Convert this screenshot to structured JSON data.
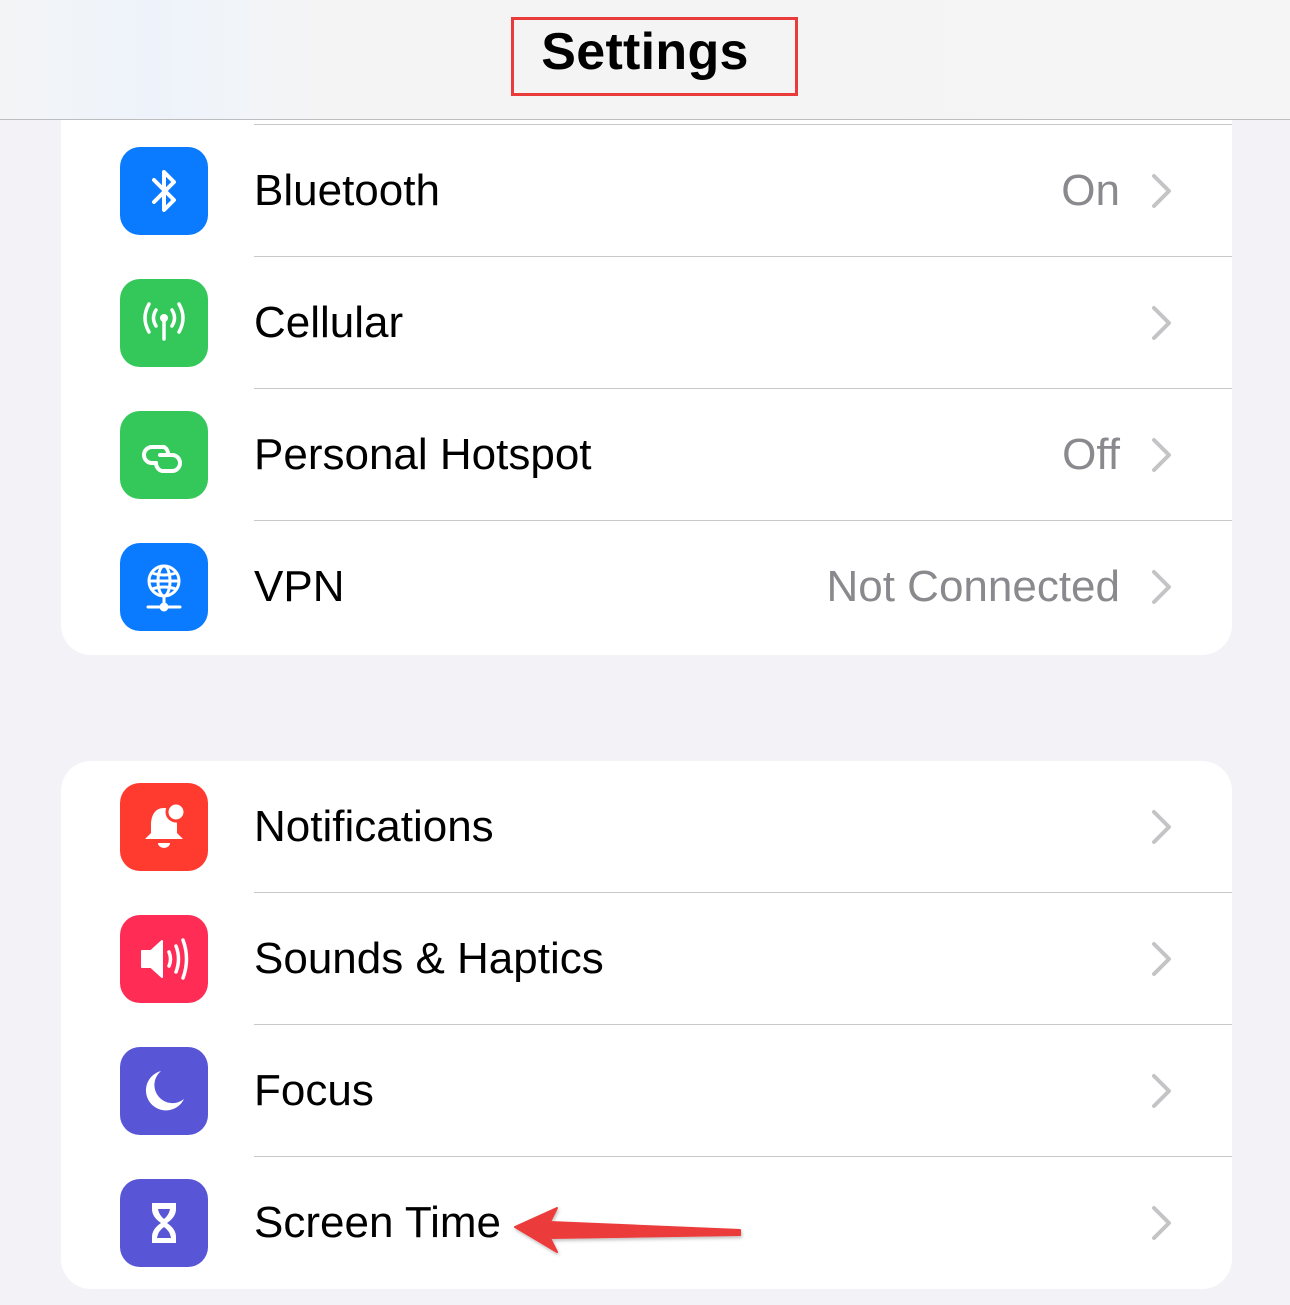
{
  "navbar": {
    "title": "Settings"
  },
  "colors": {
    "background": "#f2f2f7",
    "annotation_red": "#ea3b3b",
    "blue": "#0a7aff",
    "green": "#34c759",
    "red": "#ff3b30",
    "pink": "#ff2d55",
    "indigo": "#5856d6"
  },
  "groups": [
    {
      "items": [
        {
          "label": "Bluetooth",
          "value": "On",
          "icon": "bluetooth-icon"
        },
        {
          "label": "Cellular",
          "value": "",
          "icon": "cellular-antenna-icon"
        },
        {
          "label": "Personal Hotspot",
          "value": "Off",
          "icon": "hotspot-link-icon"
        },
        {
          "label": "VPN",
          "value": "Not Connected",
          "icon": "vpn-globe-icon"
        }
      ]
    },
    {
      "items": [
        {
          "label": "Notifications",
          "value": "",
          "icon": "notification-bell-icon"
        },
        {
          "label": "Sounds & Haptics",
          "value": "",
          "icon": "speaker-icon"
        },
        {
          "label": "Focus",
          "value": "",
          "icon": "moon-icon"
        },
        {
          "label": "Screen Time",
          "value": "",
          "icon": "hourglass-icon"
        }
      ]
    }
  ],
  "annotations": {
    "title_highlight": "red-rectangle around Settings",
    "arrow_target": "Screen Time"
  }
}
